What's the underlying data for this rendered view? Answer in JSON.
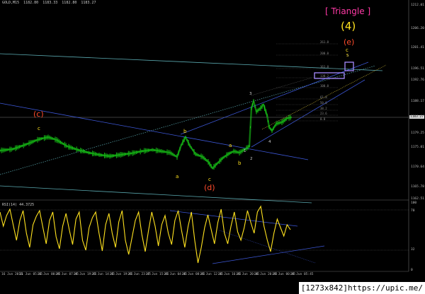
{
  "header": {
    "symbol": "GOLD,M15",
    "ohlc": [
      "1182.80",
      "1183.33",
      "1182.80",
      "1183.27"
    ]
  },
  "annotations": {
    "title": "[ Triangle ]",
    "degree": "(4)",
    "wave_e_big": "(e)",
    "wave_c_big": "(c)",
    "wave_d_big": "(d)"
  },
  "wave_labels": [
    {
      "text": "c",
      "color": "#ffe21f"
    },
    {
      "text": "b",
      "color": "#ffe21f"
    },
    {
      "text": "a",
      "color": "#ffe21f"
    },
    {
      "text": "c",
      "color": "#ffe21f"
    },
    {
      "text": "a",
      "color": "#ffe21f"
    },
    {
      "text": "b",
      "color": "#ffe21f"
    },
    {
      "text": "1",
      "color": "#cfcfcf"
    },
    {
      "text": "2",
      "color": "#cfcfcf"
    },
    {
      "text": "3",
      "color": "#cfcfcf"
    },
    {
      "text": "4",
      "color": "#cfcfcf"
    },
    {
      "text": "5",
      "color": "#cfcfcf"
    },
    {
      "text": "c",
      "color": "#ffe21f"
    },
    {
      "text": "5",
      "color": "#ffe21f"
    }
  ],
  "price_axis": [
    "1212.01",
    "1206.20",
    "1201.41",
    "1196.51",
    "1192.76",
    "1188.17",
    "1183.27",
    "1179.25",
    "1175.01",
    "1170.64",
    "1165.78",
    "1162.51"
  ],
  "current_price": "1183.27",
  "rsi": {
    "label": "RSI(14) 44.3725",
    "axis": [
      "100",
      "70",
      "32",
      "0"
    ]
  },
  "time_axis": [
    "16 Jun 2016",
    "21 Jun 05:45",
    "23 Jun 00:45",
    "24 Jun 07:45",
    "24 Jun 19:45",
    "25 Jun 14:45",
    "25 Jun 19:45",
    "26 Jun 23:45",
    "27 Jun 15:45",
    "26 Jun 04:45",
    "26 Jun 08:45",
    "26 Jun 12:45",
    "26 Jun 16:45",
    "26 Jun 20:45",
    "28 Jun 20:45",
    "29 Jun 00:45",
    "29 Jun 05:45"
  ],
  "fib_levels": [
    "261.8",
    "200.0",
    "161.8",
    "138.2",
    "100.0",
    "61.8",
    "50.0",
    "38.2",
    "23.6",
    "0.0"
  ],
  "watermark": "[1273x842]https://upic.me/",
  "colors": {
    "candle": "#19d619",
    "rsi": "#ffe21f",
    "channel": "#3d58d8",
    "teal": "#5aa9b0",
    "wave_red": "#ff4b2b",
    "wave_yellow": "#ffe21f",
    "wave_pink": "#ff3aa6"
  }
}
